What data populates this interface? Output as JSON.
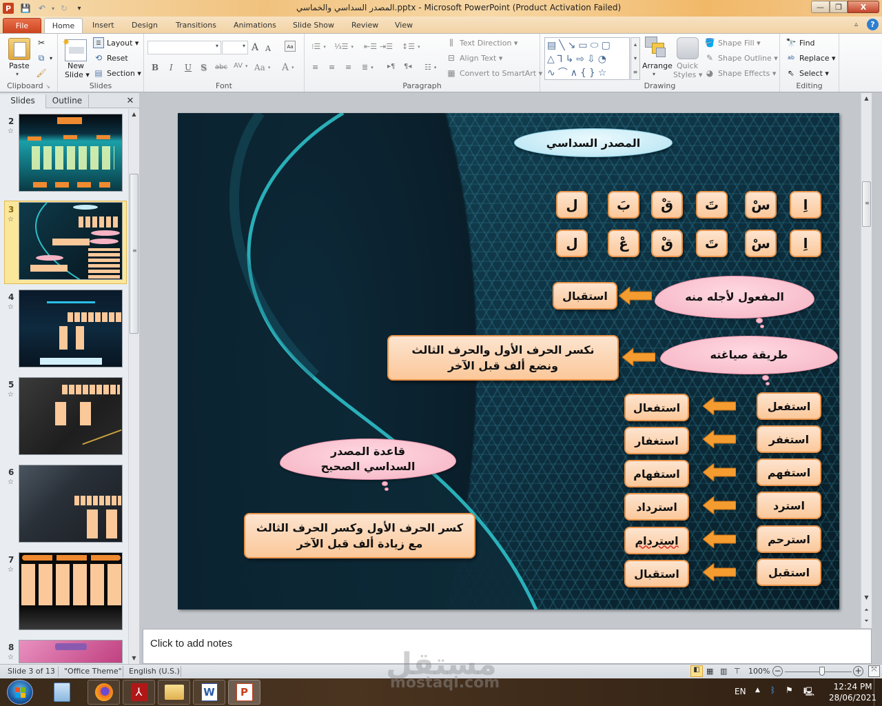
{
  "window": {
    "title": "المصدر السداسي والخماسي.pptx - Microsoft PowerPoint (Product Activation Failed)",
    "controls": {
      "minimize": "—",
      "restore": "❐",
      "close": "X"
    }
  },
  "quick_access": {
    "save": "save-icon",
    "undo": "undo-icon",
    "redo": "redo-icon",
    "customize": "▾"
  },
  "tabs": [
    {
      "label": "File"
    },
    {
      "label": "Home"
    },
    {
      "label": "Insert"
    },
    {
      "label": "Design"
    },
    {
      "label": "Transitions"
    },
    {
      "label": "Animations"
    },
    {
      "label": "Slide Show"
    },
    {
      "label": "Review"
    },
    {
      "label": "View"
    }
  ],
  "ribbon": {
    "clipboard": {
      "label": "Clipboard",
      "paste": "Paste"
    },
    "slides": {
      "label": "Slides",
      "new_slide": "New",
      "new_slide2": "Slide ▾",
      "layout": "Layout ▾",
      "reset": "Reset",
      "section": "Section ▾"
    },
    "font": {
      "label": "Font",
      "font_name": "",
      "font_size": "",
      "bold": "B",
      "italic": "I",
      "underline": "U",
      "shadow": "S",
      "strike": "abc",
      "spacing": "AV",
      "case": "Aa",
      "color": "A",
      "grow": "A",
      "shrink": "A"
    },
    "paragraph": {
      "label": "Paragraph",
      "text_direction": "Text Direction ▾",
      "align_text": "Align Text ▾",
      "smartart": "Convert to SmartArt ▾"
    },
    "drawing": {
      "label": "Drawing",
      "arrange": "Arrange",
      "quick_styles": "Quick",
      "quick_styles2": "Styles ▾",
      "shape_fill": "Shape Fill ▾",
      "shape_outline": "Shape Outline ▾",
      "shape_effects": "Shape Effects ▾"
    },
    "editing": {
      "label": "Editing",
      "find": "Find",
      "replace": "Replace ▾",
      "select": "Select ▾"
    }
  },
  "left_panel": {
    "tabs": [
      {
        "label": "Slides"
      },
      {
        "label": "Outline"
      }
    ],
    "close": "✕",
    "thumbnails": [
      {
        "number": "2"
      },
      {
        "number": "3",
        "selected": true
      },
      {
        "number": "4"
      },
      {
        "number": "5"
      },
      {
        "number": "6"
      },
      {
        "number": "7"
      },
      {
        "number": "8"
      }
    ]
  },
  "slide": {
    "title": "المصدر السداسي",
    "letters_row1": [
      "اِ",
      "سْ",
      "تَ",
      "قْ",
      "بَ",
      "ل"
    ],
    "letters_row2": [
      "اِ",
      "سْ",
      "تَ",
      "قْ",
      "عْ",
      "ل"
    ],
    "object_cloud": "المفعول لأجله منه",
    "object_box": "استقبال",
    "method_cloud": "طريقة صياغته",
    "method_box": [
      "نكسر الحرف الأول والحرف الثالث",
      "ونضع ألف قبل الآخر"
    ],
    "verbs": [
      "استفعل",
      "استغفر",
      "استفهم",
      "استرد",
      "استرحم",
      "استقبل"
    ],
    "masdars": [
      "استفعال",
      "استغفار",
      "استفهام",
      "استرداد",
      "استردام",
      "استقبال"
    ],
    "rule_cloud": [
      "قاعدة المصدر",
      "السداسي الصحيح"
    ],
    "rule_box": [
      "كسر الحرف الأول وكسر الحرف الثالث",
      "مع زيادة ألف قبل الآخر"
    ],
    "colors": {
      "box_fill": "#fbc89a",
      "box_border": "#e8934a",
      "cloud_fill": "#f5b3c3",
      "title_fill": "#c6ecf6"
    }
  },
  "notes": {
    "placeholder": "Click to add notes"
  },
  "status": {
    "slide": "Slide 3 of 13",
    "theme": "\"Office Theme\"",
    "language": "English (U.S.)",
    "zoom": "100%",
    "zoom_level_percent": 100
  },
  "taskbar": {
    "apps": [
      "calculator-icon",
      "firefox-icon",
      "acrobat-icon",
      "file-explorer-icon",
      "word-icon",
      "powerpoint-icon"
    ],
    "language": "EN",
    "time": "12:24 PM",
    "date": "28/06/2021"
  },
  "watermark": {
    "text": "مستقل",
    "sub": "mostaql.com"
  }
}
